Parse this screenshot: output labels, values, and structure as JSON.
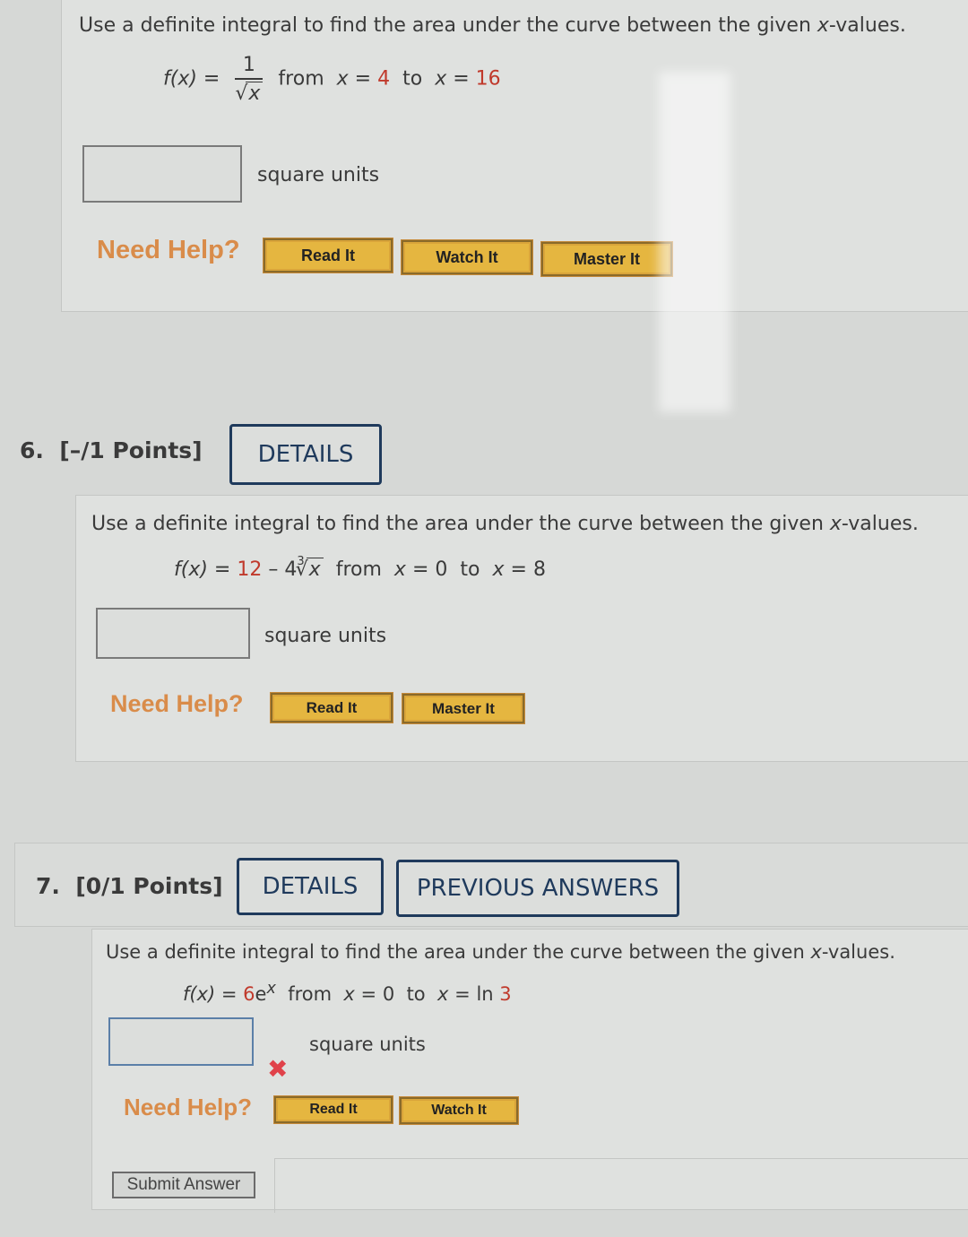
{
  "questions": [
    {
      "prompt_pre": "Use a definite integral to find the area under the curve between the given ",
      "prompt_var": "x",
      "prompt_post": "-values.",
      "function_lhs": "f(x) =",
      "function_num": "1",
      "function_den_radical": "√",
      "function_den_var": "x",
      "from_label": "from",
      "var": "x",
      "eq": "=",
      "lower": "4",
      "to_label": "to",
      "upper": "16",
      "answer_value": "",
      "units": "square units",
      "need_help": "Need Help?",
      "help_buttons": [
        "Read It",
        "Watch It",
        "Master It"
      ]
    },
    {
      "number": "6.",
      "points": "[–/1 Points]",
      "details_label": "DETAILS",
      "prompt_pre": "Use a definite integral to find the area under the curve between the given ",
      "prompt_var": "x",
      "prompt_post": "-values.",
      "function_lhs": "f(x) =",
      "function_const": "12",
      "function_rest": "– 4",
      "function_root_index": "3",
      "function_radical": "√",
      "function_var": "x",
      "from_label": "from",
      "var": "x",
      "eq": "=",
      "lower": "0",
      "to_label": "to",
      "upper": "8",
      "answer_value": "",
      "units": "square units",
      "need_help": "Need Help?",
      "help_buttons": [
        "Read It",
        "Master It"
      ]
    },
    {
      "number": "7.",
      "points": "[0/1 Points]",
      "details_label": "DETAILS",
      "previous_answers_label": "PREVIOUS ANSWERS",
      "prompt_pre": "Use a definite integral to find the area under the curve between the given ",
      "prompt_var": "x",
      "prompt_post": "-values.",
      "function_lhs": "f(x) =",
      "function_coef": "6",
      "function_base": "e",
      "function_exp": "x",
      "from_label": "from",
      "var": "x",
      "eq": "=",
      "lower": "0",
      "to_label": "to",
      "upper_prefix": "ln",
      "upper_num": "3",
      "answer_value": "",
      "units": "square units",
      "status_icon": "✖",
      "need_help": "Need Help?",
      "help_buttons": [
        "Read It",
        "Watch It"
      ],
      "submit_label": "Submit Answer"
    }
  ]
}
